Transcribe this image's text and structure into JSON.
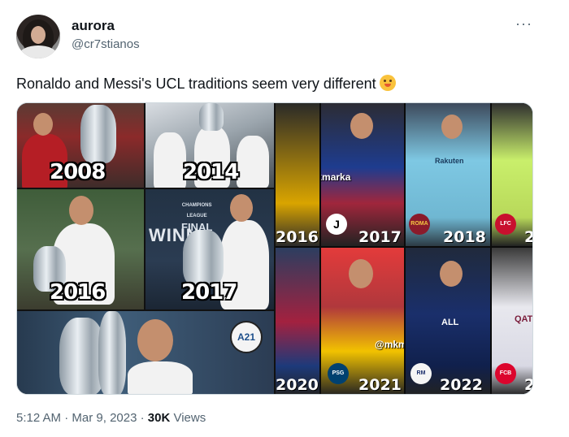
{
  "author": {
    "name": "aurora",
    "handle": "@cr7stianos"
  },
  "more_icon": "ellipsis-icon",
  "tweet": {
    "text": "Ronaldo and Messi's UCL traditions seem very different",
    "emoji": "hand-over-mouth-emoji"
  },
  "media": {
    "left_years": [
      "2008",
      "2014",
      "2016",
      "2017"
    ],
    "final_text": "FINAL",
    "champions_text": "CHAMPIONS\nLEAGUE",
    "winners_text": "WINN",
    "a21_logo": "A21",
    "watermark": "@mkmarka",
    "right_top_years": [
      "2016",
      "2017",
      "2018",
      "2"
    ],
    "right_bottom_years": [
      "2020",
      "2021",
      "2022",
      "2"
    ],
    "club_badges": {
      "juventus": "J",
      "roma": "ROMA",
      "liverpool": "LFC",
      "psg": "PSG",
      "real_madrid": "RM",
      "bayern": "FCB"
    },
    "jersey_text": {
      "rakuten": "Rakuten",
      "qatar": "QAT",
      "all": "ALL"
    }
  },
  "meta": {
    "time": "5:12 AM",
    "separator": "·",
    "date": "Mar 9, 2023",
    "views_count": "30K",
    "views_label": "Views"
  }
}
